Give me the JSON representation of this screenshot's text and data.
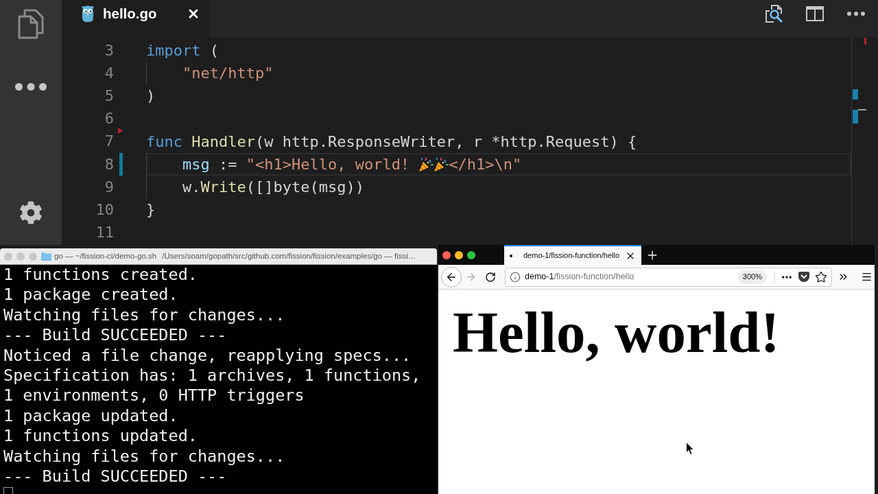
{
  "editor": {
    "tabs": [
      {
        "label": "hello.go",
        "selected": true
      }
    ],
    "lines": [
      {
        "number": "3",
        "current": false,
        "modified": false,
        "deleted": false,
        "tokens": [
          {
            "kind": "keyword",
            "text": "import"
          },
          {
            "kind": "plain",
            "text": " ("
          }
        ],
        "children": [
          {
            "number": "4",
            "current": false,
            "modified": false,
            "deleted": false,
            "tokens": [
              {
                "kind": "string",
                "text": "\"net/http\""
              }
            ]
          }
        ]
      },
      {
        "number": "5",
        "current": false,
        "modified": false,
        "deleted": false,
        "tokens": [
          {
            "kind": "plain",
            "text": ")"
          }
        ]
      },
      {
        "number": "6",
        "current": false,
        "modified": false,
        "deleted": true
      },
      {
        "number": "7",
        "current": false,
        "modified": false,
        "deleted": false,
        "tokens": [
          {
            "kind": "keyword",
            "text": "func "
          },
          {
            "kind": "function",
            "text": "Handler"
          },
          {
            "kind": "plain",
            "text": "(w http.ResponseWriter, r *http.Request) {"
          }
        ],
        "children": [
          {
            "number": "8",
            "current": true,
            "modified": true,
            "deleted": false,
            "tokens": [
              {
                "kind": "variable",
                "text": "msg"
              },
              {
                "kind": "plain",
                "text": " := "
              },
              {
                "kind": "string",
                "text": "\"<h1>Hello, world! "
              },
              {
                "kind": "emoji"
              },
              {
                "kind": "emoji"
              },
              {
                "kind": "string",
                "text": "</h1>\\n\""
              }
            ]
          },
          {
            "number": "9",
            "current": false,
            "modified": false,
            "deleted": false,
            "tokens": [
              {
                "kind": "plain",
                "text": "w."
              },
              {
                "kind": "function",
                "text": "Write"
              },
              {
                "kind": "plain",
                "text": "([]byte(msg))"
              }
            ]
          }
        ]
      },
      {
        "number": "10",
        "current": false,
        "modified": false,
        "deleted": false,
        "tokens": [
          {
            "kind": "plain",
            "text": "}"
          }
        ]
      },
      {
        "number": "11",
        "current": false,
        "modified": false,
        "deleted": false
      }
    ]
  },
  "terminal": {
    "focused": false,
    "title": [
      "go — ~/fission-ci/demo-go.sh",
      "/Users/soam/gopath/src/github.com/fission/fission/examples/go — fissi…"
    ],
    "lines": [
      "1 functions created.",
      "1 package created.",
      "Watching files for changes...",
      "--- Build SUCCEEDED ---",
      "Noticed a file change, reapplying specs...",
      "Specification has: 1 archives, 1 functions,",
      "1 environments, 0 HTTP triggers",
      "1 package updated.",
      "1 functions updated.",
      "Watching files for changes...",
      "--- Build SUCCEEDED ---"
    ]
  },
  "browser": {
    "focused": true,
    "tabs": [
      {
        "title": "demo-1/fission-function/hello",
        "selected": true
      }
    ],
    "nav": [
      {
        "kind": "back",
        "disabled": false
      },
      {
        "kind": "forward",
        "disabled": true
      },
      {
        "kind": "reload",
        "disabled": false
      }
    ],
    "url": {
      "host": "demo-1",
      "path": "/fission-function/hello"
    },
    "zoom": "300%",
    "page": {
      "heading": "Hello, world!"
    }
  }
}
